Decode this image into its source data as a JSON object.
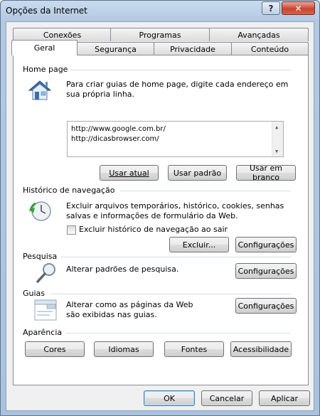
{
  "window": {
    "title": "Opções da Internet",
    "help_label": "?",
    "close_label": "✕"
  },
  "tabs": {
    "row1": [
      "Conexões",
      "Programas",
      "Avançadas"
    ],
    "row2": [
      "Geral",
      "Segurança",
      "Privacidade",
      "Conteúdo"
    ],
    "active": "Geral"
  },
  "homepage": {
    "group_label": "Home page",
    "description": "Para criar guias de home page, digite cada endereço em sua própria linha.",
    "urls": [
      "http://www.google.com.br/",
      "http://dicasbrowser.com/"
    ],
    "use_current": "Usar atual",
    "use_default": "Usar padrão",
    "use_blank": "Usar em branco"
  },
  "history": {
    "group_label": "Histórico de navegação",
    "description": "Excluir arquivos temporários, histórico, cookies, senhas salvas e informações de formulário da Web.",
    "checkbox_label": "Excluir histórico de navegação ao sair",
    "delete_button": "Excluir...",
    "settings_button": "Configurações"
  },
  "search": {
    "group_label": "Pesquisa",
    "description": "Alterar padrões de pesquisa.",
    "settings_button": "Configurações"
  },
  "tabs_group": {
    "group_label": "Guias",
    "description": "Alterar como as páginas da Web são exibidas nas guias.",
    "settings_button": "Configurações"
  },
  "appearance": {
    "group_label": "Aparência",
    "colors": "Cores",
    "languages": "Idiomas",
    "fonts": "Fontes",
    "accessibility": "Acessibilidade"
  },
  "footer": {
    "ok": "OK",
    "cancel": "Cancelar",
    "apply": "Aplicar"
  }
}
